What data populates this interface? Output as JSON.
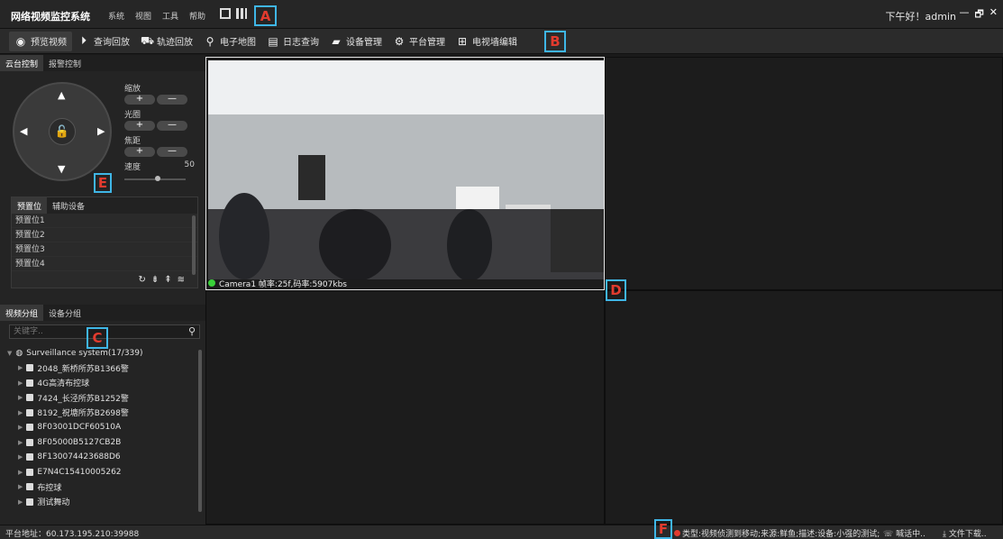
{
  "titlebar": {
    "app_title": "网络视频监控系统",
    "menu": [
      "系统",
      "视图",
      "工具",
      "帮助"
    ],
    "greeting": "下午好！admin",
    "window_controls": [
      "—",
      "🗗",
      "✕"
    ]
  },
  "markers": [
    "A",
    "B",
    "C",
    "D",
    "E",
    "F"
  ],
  "toolbar": {
    "items": [
      {
        "label": "预览视频",
        "icon": "preview-icon"
      },
      {
        "label": "查询回放",
        "icon": "playback-icon"
      },
      {
        "label": "轨迹回放",
        "icon": "track-icon"
      },
      {
        "label": "电子地图",
        "icon": "map-pin-icon"
      },
      {
        "label": "日志查询",
        "icon": "log-icon"
      },
      {
        "label": "设备管理",
        "icon": "device-icon"
      },
      {
        "label": "平台管理",
        "icon": "gear-icon"
      },
      {
        "label": "电视墙编辑",
        "icon": "tv-wall-icon"
      }
    ]
  },
  "left_panel": {
    "ptz_tabs": [
      "云台控制",
      "报警控制"
    ],
    "zoom_label": "缩放",
    "iris_label": "光圈",
    "focus_label": "焦距",
    "speed_label": "速度",
    "speed_value": "50",
    "plus": "+",
    "minus": "—",
    "preset_tabs": [
      "预置位",
      "辅助设备"
    ],
    "presets": [
      "预置位1",
      "预置位2",
      "预置位3",
      "预置位4"
    ],
    "group_tabs": [
      "视频分组",
      "设备分组"
    ],
    "search_placeholder": "关键字..",
    "tree_root": "Surveillance system(17/339)",
    "devices": [
      "2048_新桥所苏B1366警",
      "4G高清布控球",
      "7424_长泾所苏B1252警",
      "8192_祝塘所苏B2698警",
      "8F03001DCF60510A",
      "8F05000B5127CB2B",
      "8F130074423688D6",
      "E7N4C15410005262",
      "布控球",
      "测试舞动"
    ]
  },
  "video": {
    "camera_status": "Camera1 帧率:25f,码率:5907kbs"
  },
  "statusbar": {
    "platform_address": "平台地址：60.173.195.210:39988",
    "alarm_text": "类型:视频侦测到移动;来源:鲜鱼;描述:设备:小强的测试;",
    "call_text": "喊话中..",
    "download_text": "文件下载.."
  }
}
